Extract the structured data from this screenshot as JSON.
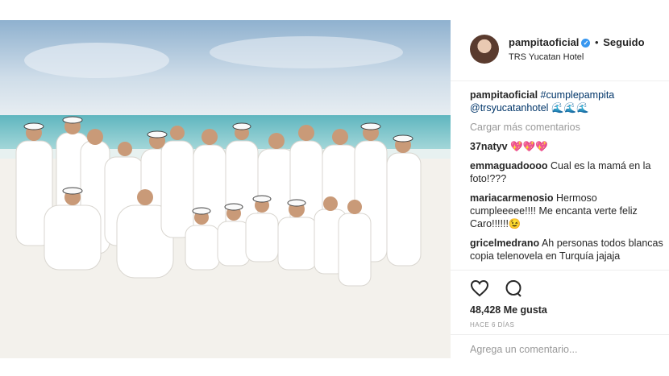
{
  "post": {
    "photo_alt": "group-beach-photo"
  },
  "header": {
    "username": "pampitaoficial",
    "separator": "•",
    "follow_label": "Seguido",
    "location": "TRS Yucatan Hotel"
  },
  "caption": {
    "username": "pampitaoficial",
    "hashtag": "#cumplepampita",
    "mention": "@trsyucatanhotel",
    "emoji": "🌊🌊🌊"
  },
  "load_more": "Cargar más comentarios",
  "comments": [
    {
      "username": "37natyv",
      "text": "💖💖💖"
    },
    {
      "username": "emmaguadoooo",
      "text": "Cual es la mamá en la foto!???"
    },
    {
      "username": "mariacarmenosio",
      "text": "Hermoso cumpleeeee!!!! Me encanta verte feliz Caro!!!!!!😉"
    },
    {
      "username": "gricelmedrano",
      "text": "Ah personas todos blancas copia telenovela en Turquía jajaja"
    }
  ],
  "likes": "48,428 Me gusta",
  "timestamp": "HACE 6 DÍAS",
  "add_comment_placeholder": "Agrega un comentario...",
  "icons": {
    "like": "heart-icon",
    "comment": "comment-icon",
    "verified": "verified-badge-icon"
  },
  "colors": {
    "link": "#003569",
    "muted": "#999999",
    "verified": "#3897f0"
  }
}
